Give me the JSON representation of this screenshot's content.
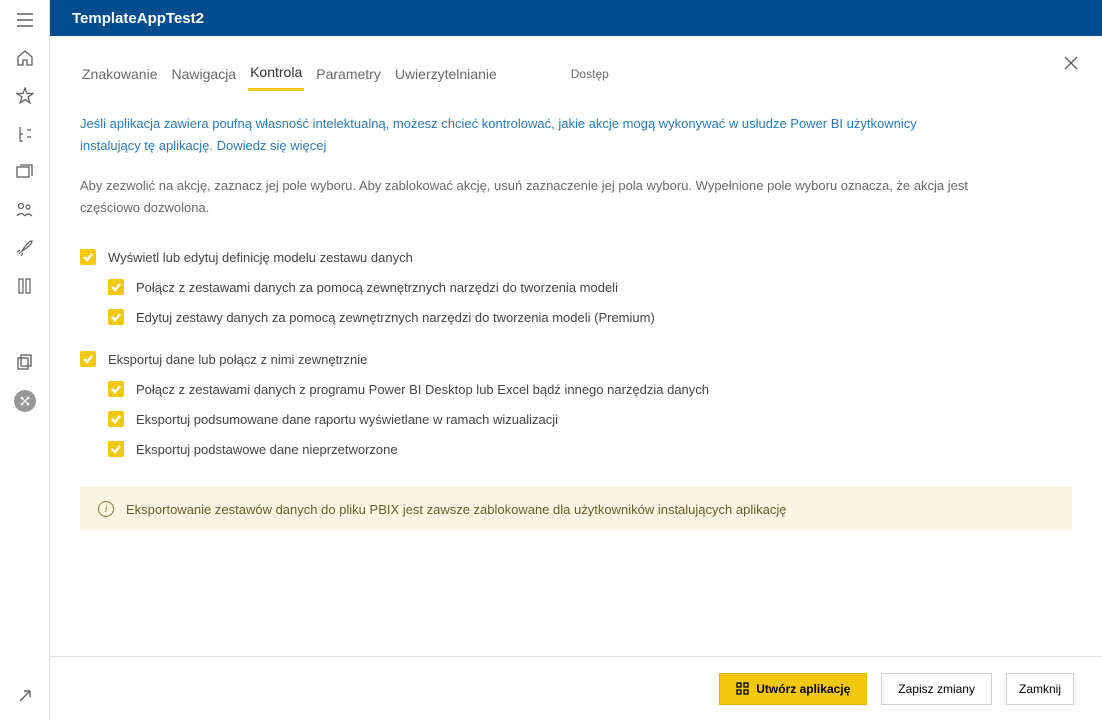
{
  "header": {
    "title": "TemplateAppTest2"
  },
  "tabs": {
    "items": [
      "Znakowanie",
      "Nawigacja",
      "Kontrola",
      "Parametry",
      "Uwierzytelnianie"
    ],
    "last": "Dostęp",
    "activeIndex": 2
  },
  "intro": {
    "text": "Jeśli aplikacja zawiera poufną własność intelektualną, możesz chcieć kontrolować, jakie akcje mogą wykonywać w usłudze Power BI użytkownicy instalujący tę aplikację. ",
    "link": "Dowiedz się więcej"
  },
  "helper": "Aby zezwolić na akcję, zaznacz jej pole wyboru. Aby zablokować akcję, usuń zaznaczenie jej pola wyboru. Wypełnione pole wyboru oznacza, że akcja jest częściowo dozwolona.",
  "group1": {
    "label": "Wyświetl lub edytuj definicję modelu zestawu danych",
    "sub": [
      "Połącz z zestawami danych za pomocą zewnętrznych narzędzi do tworzenia modeli",
      "Edytuj zestawy danych za pomocą zewnętrznych narzędzi do tworzenia modeli (Premium)"
    ]
  },
  "group2": {
    "label": "Eksportuj dane lub połącz z nimi zewnętrznie",
    "sub": [
      "Połącz z zestawami danych z programu Power BI Desktop lub Excel bądź innego narzędzia danych",
      "Eksportuj podsumowane dane raportu wyświetlane w ramach wizualizacji",
      "Eksportuj podstawowe dane nieprzetworzone"
    ]
  },
  "info": "Eksportowanie zestawów danych do pliku PBIX jest zawsze zablokowane dla użytkowników instalujących aplikację",
  "footer": {
    "create": "Utwórz aplikację",
    "save": "Zapisz zmiany",
    "close": "Zamknij"
  }
}
